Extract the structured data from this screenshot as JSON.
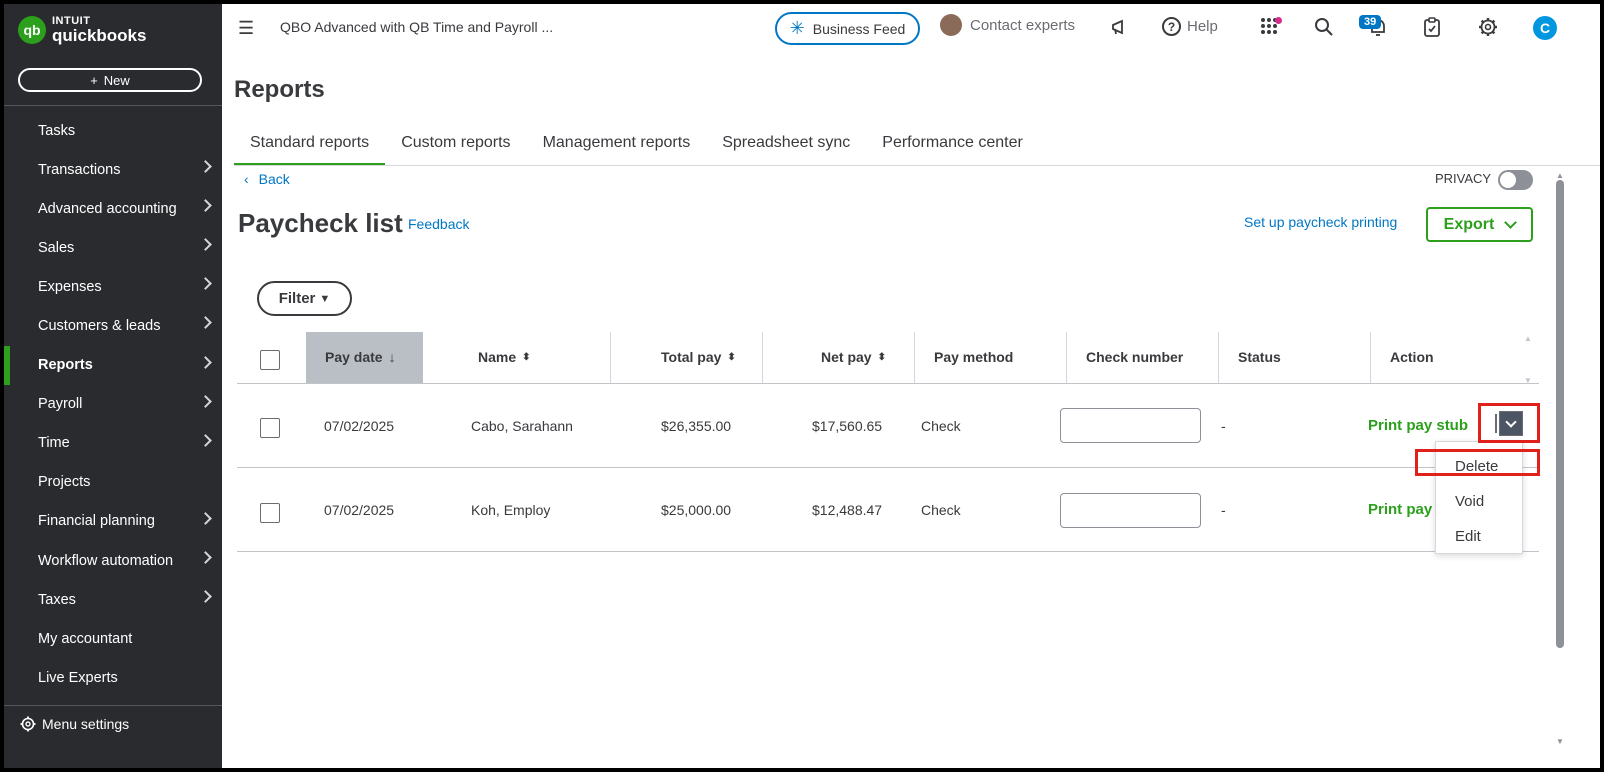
{
  "sidebar": {
    "logo_top": "INTUIT",
    "logo_bottom": "quickbooks",
    "logo_badge": "qb",
    "new_label": "New",
    "items": [
      {
        "label": "Tasks"
      },
      {
        "label": "Transactions"
      },
      {
        "label": "Advanced accounting"
      },
      {
        "label": "Sales"
      },
      {
        "label": "Expenses"
      },
      {
        "label": "Customers & leads"
      },
      {
        "label": "Reports"
      },
      {
        "label": "Payroll"
      },
      {
        "label": "Time"
      },
      {
        "label": "Projects"
      },
      {
        "label": "Financial planning"
      },
      {
        "label": "Workflow automation"
      },
      {
        "label": "Taxes"
      },
      {
        "label": "My accountant"
      },
      {
        "label": "Live Experts"
      }
    ],
    "menu_settings": "Menu settings",
    "accent_color": "#2ca01c"
  },
  "topbar": {
    "company": "QBO Advanced with QB Time and Payroll ...",
    "business_feed": "Business Feed",
    "contact_experts": "Contact experts",
    "help": "Help",
    "help_glyph": "?",
    "notification_count": "39",
    "user_initial": "C"
  },
  "page": {
    "title": "Reports",
    "tabs": [
      {
        "label": "Standard reports"
      },
      {
        "label": "Custom reports"
      },
      {
        "label": "Management reports"
      },
      {
        "label": "Spreadsheet sync"
      },
      {
        "label": "Performance center"
      }
    ],
    "active_tab": "Standard reports",
    "back": "Back",
    "privacy": "PRIVACY",
    "privacy_on": false
  },
  "paycheck_list": {
    "title": "Paycheck list",
    "feedback": "Feedback",
    "setup_printing": "Set up paycheck printing",
    "export": "Export",
    "filter": "Filter",
    "columns": {
      "pay_date": "Pay date",
      "name": "Name",
      "total_pay": "Total pay",
      "net_pay": "Net pay",
      "pay_method": "Pay method",
      "check_number": "Check number",
      "status": "Status",
      "action": "Action"
    },
    "rows": [
      {
        "pay_date": "07/02/2025",
        "name": "Cabo, Sarahann",
        "total_pay": "$26,355.00",
        "net_pay": "$17,560.65",
        "pay_method": "Check",
        "check_number": "",
        "status": "-",
        "action": "Print pay stub"
      },
      {
        "pay_date": "07/02/2025",
        "name": "Koh, Employ",
        "total_pay": "$25,000.00",
        "net_pay": "$12,488.47",
        "pay_method": "Check",
        "check_number": "",
        "status": "-",
        "action": "Print pay"
      }
    ],
    "action_menu": [
      "Delete",
      "Void",
      "Edit"
    ]
  }
}
